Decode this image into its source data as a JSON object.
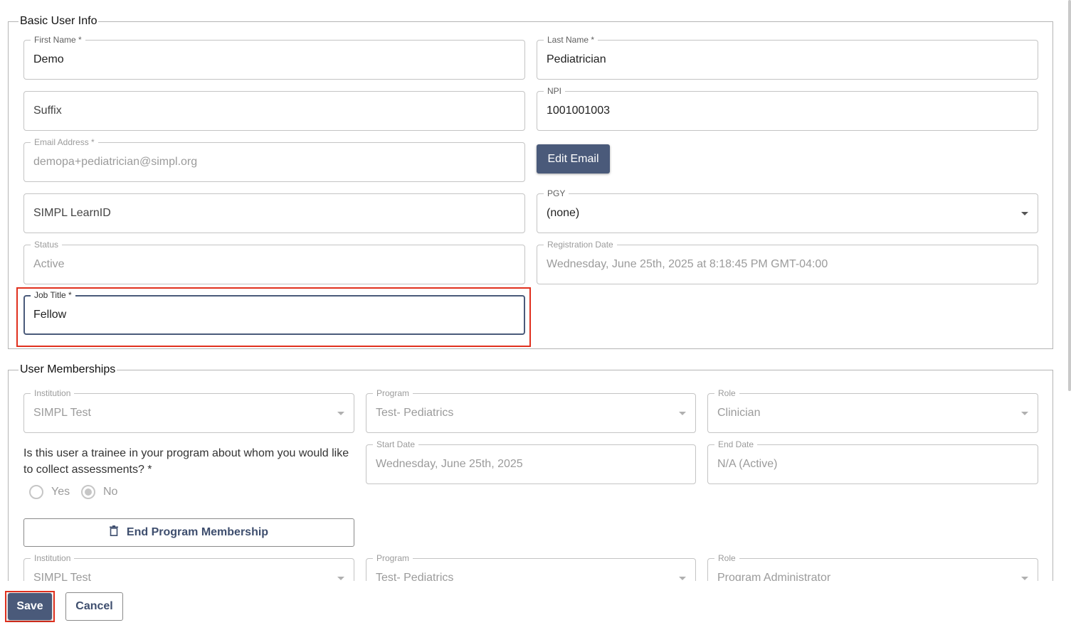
{
  "basic_info": {
    "legend": "Basic User Info",
    "first_name": {
      "label": "First Name *",
      "value": "Demo"
    },
    "last_name": {
      "label": "Last Name *",
      "value": "Pediatrician"
    },
    "suffix": {
      "placeholder": "Suffix"
    },
    "npi": {
      "label": "NPI",
      "value": "1001001003"
    },
    "email": {
      "label": "Email Address *",
      "value": "demopa+pediatrician@simpl.org"
    },
    "edit_email_button": "Edit Email",
    "learn_id": {
      "placeholder": "SIMPL LearnID"
    },
    "pgy": {
      "label": "PGY",
      "value": "(none)"
    },
    "status": {
      "label": "Status",
      "value": "Active"
    },
    "registration_date": {
      "label": "Registration Date",
      "value": "Wednesday, June 25th, 2025 at 8:18:45 PM GMT-04:00"
    },
    "job_title": {
      "label": "Job Title *",
      "value": "Fellow"
    }
  },
  "memberships": {
    "legend": "User Memberships",
    "items": [
      {
        "institution": {
          "label": "Institution",
          "value": "SIMPL Test"
        },
        "program": {
          "label": "Program",
          "value": "Test- Pediatrics"
        },
        "role": {
          "label": "Role",
          "value": "Clinician"
        },
        "question": "Is this user a trainee in your program about whom you would like to collect assessments? *",
        "options": [
          "Yes",
          "No"
        ],
        "selected": "No",
        "start_date": {
          "label": "Start Date",
          "value": "Wednesday, June 25th, 2025"
        },
        "end_date": {
          "label": "End Date",
          "value": "N/A (Active)"
        },
        "end_button": "End Program Membership"
      },
      {
        "institution": {
          "label": "Institution",
          "value": "SIMPL Test"
        },
        "program": {
          "label": "Program",
          "value": "Test- Pediatrics"
        },
        "role": {
          "label": "Role",
          "value": "Program Administrator"
        }
      }
    ]
  },
  "footer": {
    "save": "Save",
    "cancel": "Cancel"
  },
  "colors": {
    "primary": "#4a5a7a",
    "highlight": "#e0301e"
  },
  "icons": {
    "trash": "trash-icon",
    "dropdown": "chevron-down-icon"
  }
}
